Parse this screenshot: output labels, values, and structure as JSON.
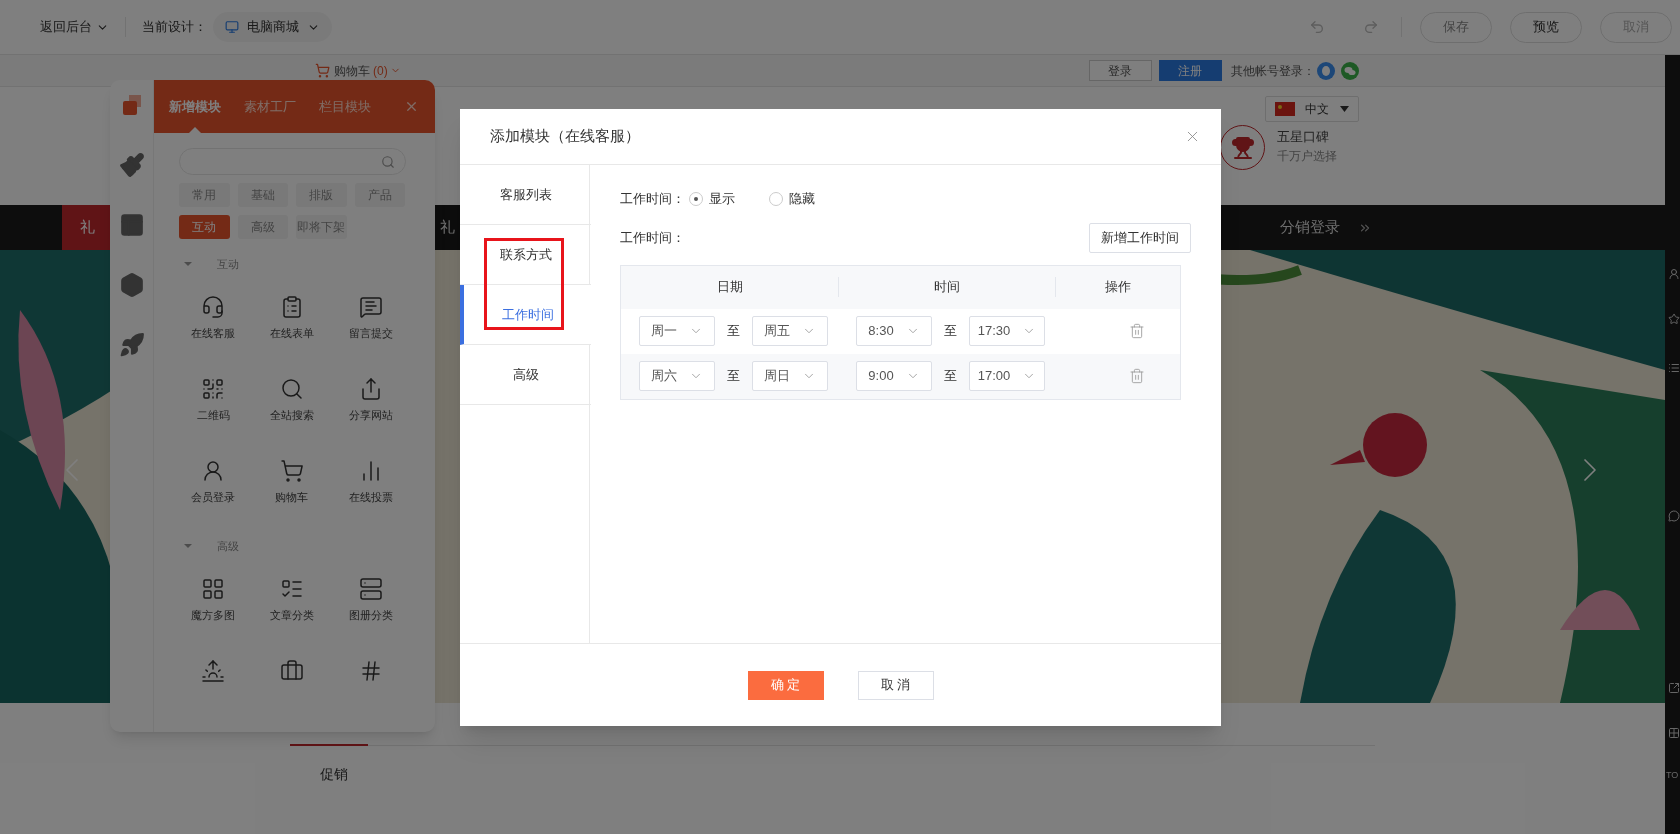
{
  "editor_bar": {
    "back": "返回后台",
    "design_label": "当前设计：",
    "design": "电脑商城",
    "buttons": [
      {
        "label": "保存",
        "disabled": false
      },
      {
        "label": "预览",
        "disabled": false
      },
      {
        "label": "取消",
        "disabled": true
      }
    ]
  },
  "site": {
    "cart": "购物车",
    "cart_count": "(0)",
    "login": "登录",
    "register": "注册",
    "other_login": "其他帐号登录：",
    "language": "中文",
    "badge_title": "五星口碑",
    "badge_subtitle": "千万户选择",
    "nav": [
      {
        "label": "礼",
        "selected": true
      },
      {
        "label": "礼",
        "selected": false
      }
    ],
    "nav_right": "分销登录",
    "bottom_tab": "促销",
    "side_label": "TO"
  },
  "panel": {
    "side_tabs": [
      {
        "kind": "modules",
        "selected": true
      },
      {
        "kind": "brush",
        "selected": false
      },
      {
        "kind": "layout",
        "selected": false
      },
      {
        "kind": "hexagon",
        "selected": false
      },
      {
        "kind": "rocket",
        "selected": false
      }
    ],
    "tabs": [
      {
        "label": "新增模块",
        "selected": true
      },
      {
        "label": "素材工厂",
        "selected": false
      },
      {
        "label": "栏目模块",
        "selected": false
      }
    ],
    "categories": [
      {
        "label": "常用",
        "selected": false
      },
      {
        "label": "基础",
        "selected": false
      },
      {
        "label": "排版",
        "selected": false
      },
      {
        "label": "产品",
        "selected": false
      },
      {
        "label": "互动",
        "selected": true
      },
      {
        "label": "高级",
        "selected": false
      },
      {
        "label": "即将下架",
        "selected": false
      }
    ],
    "groups": [
      {
        "title": "互动",
        "expanded": true,
        "items": [
          {
            "label": "在线客服",
            "kind": "headset"
          },
          {
            "label": "在线表单",
            "kind": "clipboard"
          },
          {
            "label": "留言提交",
            "kind": "message"
          },
          {
            "label": "二维码",
            "kind": "qr"
          },
          {
            "label": "全站搜索",
            "kind": "search"
          },
          {
            "label": "分享网站",
            "kind": "share"
          },
          {
            "label": "会员登录",
            "kind": "user"
          },
          {
            "label": "购物车",
            "kind": "cart"
          },
          {
            "label": "在线投票",
            "kind": "bars"
          }
        ]
      },
      {
        "title": "高级",
        "expanded": true,
        "items": [
          {
            "label": "魔方多图",
            "kind": "grid"
          },
          {
            "label": "文章分类",
            "kind": "list"
          },
          {
            "label": "图册分类",
            "kind": "server"
          },
          {
            "kind": "sun"
          },
          {
            "kind": "bag"
          },
          {
            "kind": "number"
          }
        ]
      }
    ]
  },
  "dialog": {
    "title": "添加模块（在线客服）",
    "tabs": [
      {
        "label": "客服列表",
        "selected": false
      },
      {
        "label": "联系方式",
        "selected": false
      },
      {
        "label": "工作时间",
        "selected": true
      },
      {
        "label": "高级",
        "selected": false
      }
    ],
    "show_setting": {
      "label": "工作时间：",
      "options": [
        {
          "label": "显示",
          "selected": true
        },
        {
          "label": "隐藏",
          "selected": false
        }
      ]
    },
    "list_label": "工作时间：",
    "add_button": "新增工作时间",
    "columns": [
      "日期",
      "时间",
      "操作"
    ],
    "rows": [
      {
        "day_from": "周一",
        "sep_day": "至",
        "day_to": "周五",
        "time_from": "8:30",
        "sep_time": "至",
        "time_to": "17:30"
      },
      {
        "day_from": "周六",
        "sep_day": "至",
        "day_to": "周日",
        "time_from": "9:00",
        "sep_time": "至",
        "time_to": "17:00"
      }
    ],
    "buttons": [
      {
        "label": "确 定",
        "kind": "primary"
      },
      {
        "label": "取 消",
        "kind": "default"
      }
    ]
  }
}
